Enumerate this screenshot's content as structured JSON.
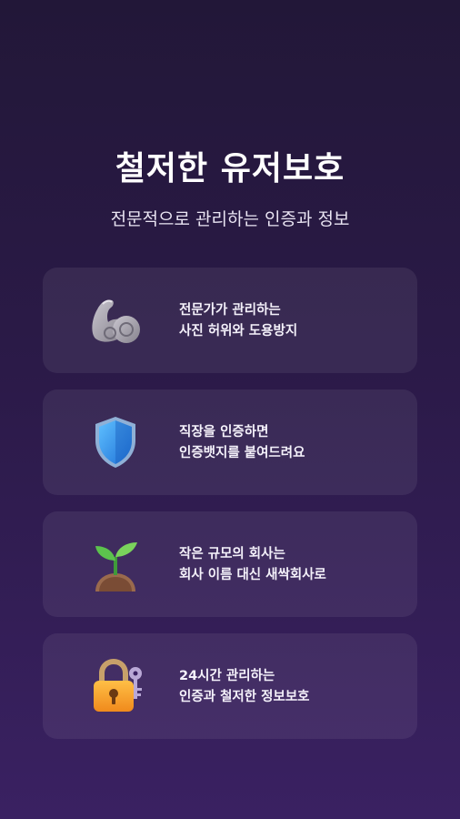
{
  "header": {
    "title": "철저한 유저보호",
    "subtitle": "전문적으로 관리하는 인증과 정보"
  },
  "features": [
    {
      "icon": "flexed-biceps-icon",
      "line1": "전문가가 관리하는",
      "line2": "사진 허위와 도용방지"
    },
    {
      "icon": "shield-icon",
      "line1": "직장을 인증하면",
      "line2": "인증뱃지를 붙여드려요"
    },
    {
      "icon": "seedling-icon",
      "line1": "작은 규모의 회사는",
      "line2": "회사 이름 대신 새싹회사로"
    },
    {
      "icon": "locked-with-key-icon",
      "line1": "24시간 관리하는",
      "line2": "인증과 철저한 정보보호"
    }
  ]
}
